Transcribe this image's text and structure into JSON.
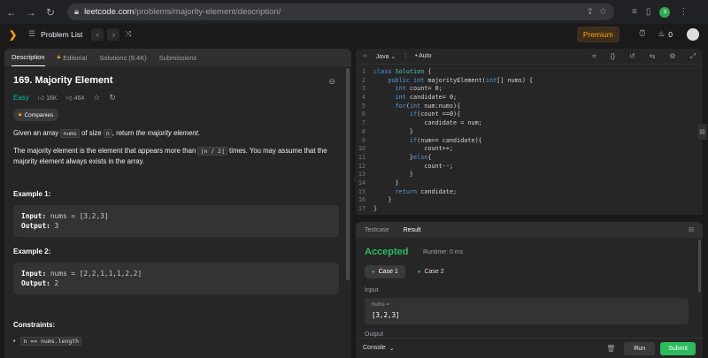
{
  "browser": {
    "host": "leetcode.com",
    "path": "/problems/majority-element/description/",
    "profile_initial": "s"
  },
  "nav": {
    "problem_list": "Problem List",
    "premium": "Premium",
    "streak_count": "0"
  },
  "tabs": [
    {
      "label": "Description"
    },
    {
      "label": "Editorial"
    },
    {
      "label": "Solutions (9.4K)"
    },
    {
      "label": "Submissions"
    }
  ],
  "problem": {
    "title": "169. Majority Element",
    "difficulty": "Easy",
    "likes": "16K",
    "dislikes": "464",
    "companies_label": "Companies",
    "p1_a": "Given an array ",
    "p1_code1": "nums",
    "p1_b": " of size ",
    "p1_code2": "n",
    "p1_c": ", return ",
    "p1_em": "the majority element",
    "p1_d": ".",
    "p2_a": "The majority element is the element that appears more than ",
    "p2_code": "⌊n / 2⌋",
    "p2_b": " times. You may assume that the majority element always exists in the array.",
    "example1_title": "Example 1:",
    "example1_input_label": "Input:",
    "example1_input": " nums = [3,2,3]",
    "example1_output_label": "Output:",
    "example1_output": " 3",
    "example2_title": "Example 2:",
    "example2_input_label": "Input:",
    "example2_input": " nums = [2,2,1,1,1,2,2]",
    "example2_output_label": "Output:",
    "example2_output": " 2",
    "constraints_title": "Constraints:",
    "constraint1": "n == nums.length"
  },
  "editor": {
    "language": "Java",
    "mode": "Auto"
  },
  "code": [
    {
      "n": "1",
      "t": "class Solution {"
    },
    {
      "n": "2",
      "t": "    public int majorityElement(int[] nums) {"
    },
    {
      "n": "3",
      "t": "      int count= 0;"
    },
    {
      "n": "4",
      "t": "      int candidate= 0;"
    },
    {
      "n": "5",
      "t": "      for(int num:nums){"
    },
    {
      "n": "6",
      "t": "          if(count ==0){"
    },
    {
      "n": "7",
      "t": "              candidate = num;"
    },
    {
      "n": "8",
      "t": "          }"
    },
    {
      "n": "9",
      "t": "          if(num== candidate){"
    },
    {
      "n": "10",
      "t": "              count++;"
    },
    {
      "n": "11",
      "t": "          }else{"
    },
    {
      "n": "12",
      "t": "              count--;"
    },
    {
      "n": "13",
      "t": "          }"
    },
    {
      "n": "14",
      "t": "      }"
    },
    {
      "n": "15",
      "t": "      return candidate;"
    },
    {
      "n": "16",
      "t": "    }"
    },
    {
      "n": "17",
      "t": "}"
    }
  ],
  "result": {
    "tab_testcase": "Testcase",
    "tab_result": "Result",
    "status": "Accepted",
    "runtime": "Runtime: 0 ms",
    "case1": "Case 1",
    "case2": "Case 2",
    "input_label": "Input",
    "input_key": "nums =",
    "input_value": "[3,2,3]",
    "output_label": "Output"
  },
  "bottom": {
    "console": "Console",
    "run": "Run",
    "submit": "Submit"
  }
}
